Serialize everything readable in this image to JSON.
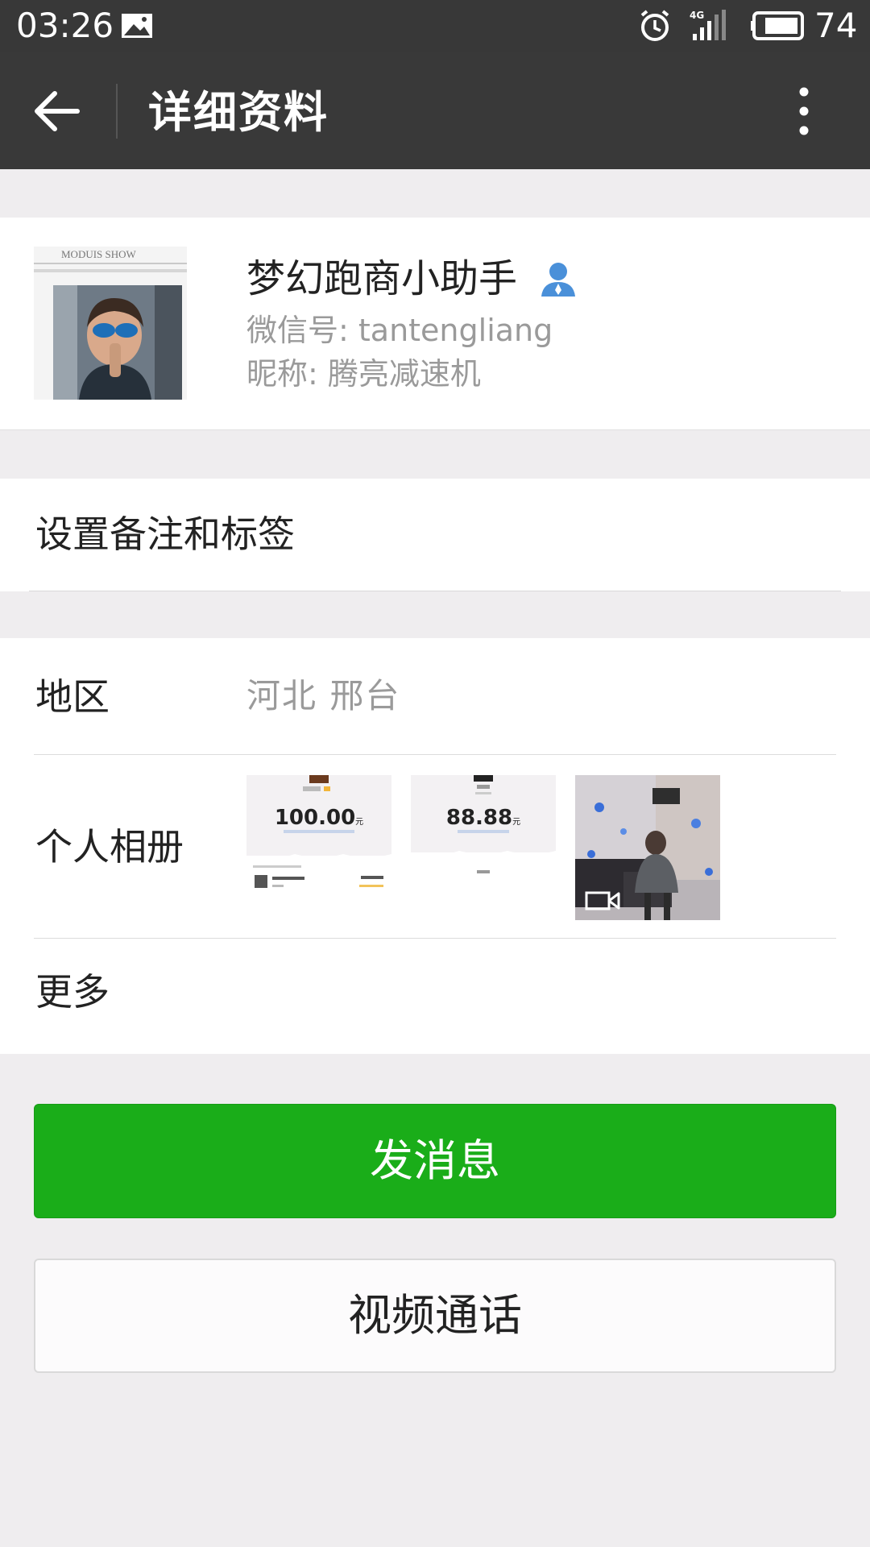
{
  "status_bar": {
    "time": "03:26",
    "network": "4G",
    "battery": "74",
    "icons": [
      "image-notification-icon",
      "alarm-icon",
      "signal-icon",
      "battery-icon"
    ]
  },
  "app_bar": {
    "title": "详细资料",
    "back_icon": "back-arrow-icon",
    "menu_icon": "more-vertical-icon"
  },
  "profile": {
    "name": "梦幻跑商小助手",
    "wechat_id": "微信号: tantengliang",
    "nickname": "昵称: 腾亮减速机",
    "avatar_caption": "MODUIS SHOW",
    "contact_icon": "contact-person-icon"
  },
  "remark": {
    "label": "设置备注和标签"
  },
  "region": {
    "label": "地区",
    "value": "河北  邢台"
  },
  "album": {
    "label": "个人相册",
    "thumbs": [
      {
        "amount": "100.00",
        "unit": "元"
      },
      {
        "amount": "88.88",
        "unit": "元"
      },
      {
        "type": "video",
        "icon": "video-camera-icon"
      }
    ]
  },
  "more": {
    "label": "更多"
  },
  "actions": {
    "send_message": "发消息",
    "video_call": "视频通话"
  },
  "colors": {
    "primary_green": "#1aad19",
    "app_bar": "#393939",
    "background": "#efedef"
  }
}
